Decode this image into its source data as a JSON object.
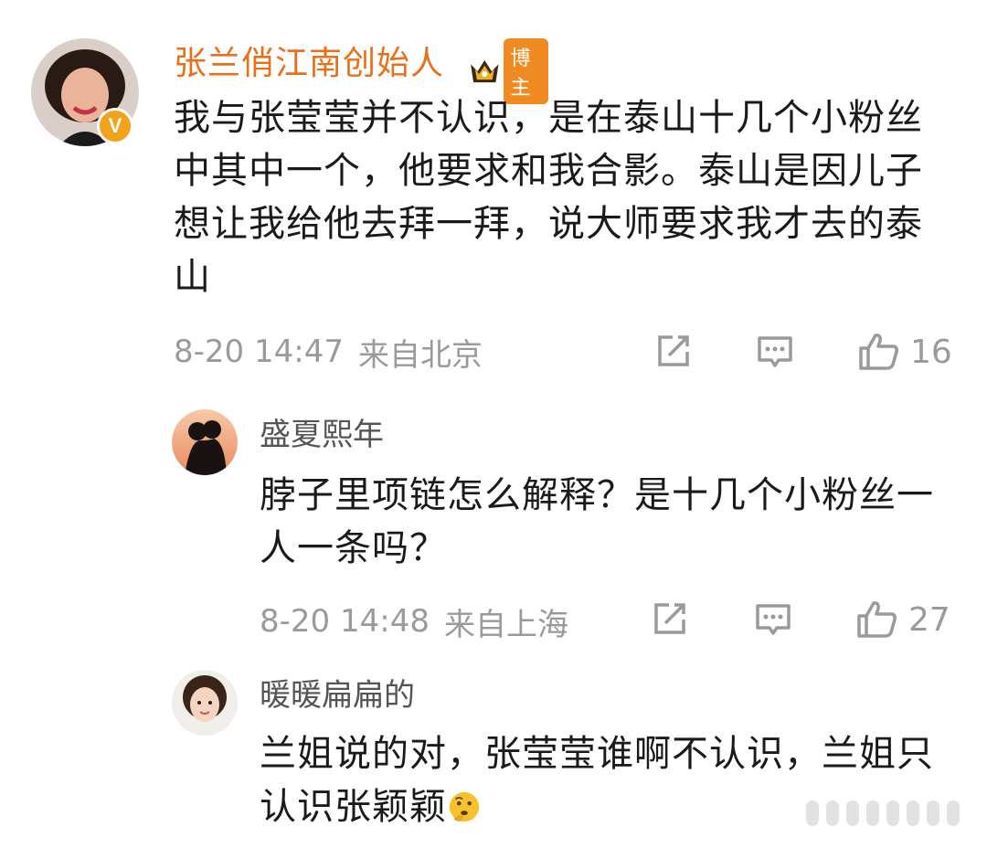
{
  "comments": [
    {
      "username": "张兰俏江南创始人",
      "badge": "博主",
      "verified_mark": "V",
      "text": "我与张莹莹并不认识，是在泰山十几个小粉丝中其中一个，他要求和我合影。泰山是因儿子想让我给他去拜一拜，说大师要求我才去的泰山",
      "date": "8-20 14:47",
      "location": "来自北京",
      "likes": "16"
    },
    {
      "username": "盛夏熙年",
      "text": "脖子里项链怎么解释？是十几个小粉丝一人一条吗？",
      "date": "8-20 14:48",
      "location": "来自上海",
      "likes": "27"
    },
    {
      "username": "暖暖扁扁的",
      "text": "兰姐说的对，张莹莹谁啊不认识，兰姐只认识张颖颖"
    }
  ],
  "icons": {
    "share": "share-icon",
    "comment": "comment-icon",
    "like": "thumbs-up-icon",
    "crown": "crown-icon",
    "emoji": "thinking-face-emoji"
  },
  "colors": {
    "username_primary": "#e8701b",
    "badge": "#f08a22",
    "meta": "#9a9a9a"
  }
}
